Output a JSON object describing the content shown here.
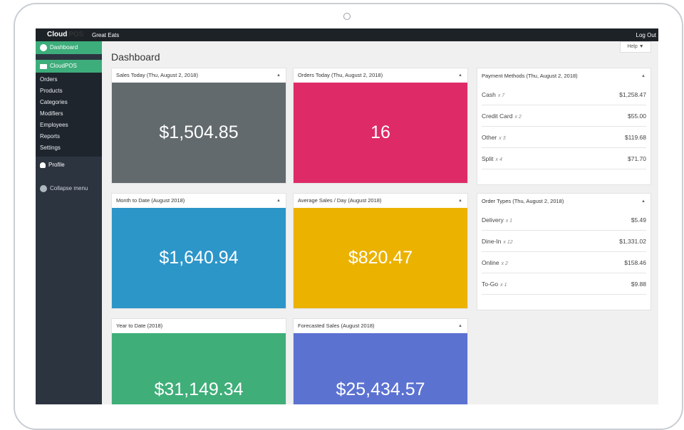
{
  "topbar": {
    "brand": "Cloud",
    "store": "Great Eats",
    "logout": "Log Out"
  },
  "sidebar": {
    "dashboard": "Dashboard",
    "cloudpos": "CloudPOS",
    "sub": [
      "Orders",
      "Products",
      "Categories",
      "Modifiers",
      "Employees",
      "Reports",
      "Settings"
    ],
    "profile": "Profile",
    "collapse": "Collapse menu"
  },
  "main": {
    "title": "Dashboard",
    "help": "Help ▼"
  },
  "cards": {
    "sales_today": {
      "title": "Sales Today (Thu, August 2, 2018)",
      "value": "$1,504.85",
      "color": "#626a6d"
    },
    "orders_today": {
      "title": "Orders Today (Thu, August 2, 2018)",
      "value": "16",
      "color": "#de2b68"
    },
    "month_to_date": {
      "title": "Month to Date (August 2018)",
      "value": "$1,640.94",
      "color": "#2d96c9"
    },
    "avg_sales": {
      "title": "Average Sales / Day (August 2018)",
      "value": "$820.47",
      "color": "#ecb200"
    },
    "year_to_date": {
      "title": "Year to Date (2018)",
      "value": "$31,149.34",
      "color": "#3fae79"
    },
    "forecast": {
      "title": "Forecasted Sales (August 2018)",
      "value": "$25,434.57",
      "color": "#5b72d1"
    }
  },
  "payment_methods": {
    "title": "Payment Methods (Thu, August 2, 2018)",
    "rows": [
      {
        "name": "Cash",
        "count": "x 7",
        "amount": "$1,258.47"
      },
      {
        "name": "Credit Card",
        "count": "x 2",
        "amount": "$55.00"
      },
      {
        "name": "Other",
        "count": "x 3",
        "amount": "$119.68"
      },
      {
        "name": "Split",
        "count": "x 4",
        "amount": "$71.70"
      }
    ]
  },
  "order_types": {
    "title": "Order Types (Thu, August 2, 2018)",
    "rows": [
      {
        "name": "Delivery",
        "count": "x 1",
        "amount": "$5.49"
      },
      {
        "name": "Dine-In",
        "count": "x 12",
        "amount": "$1,331.02"
      },
      {
        "name": "Online",
        "count": "x 2",
        "amount": "$158.46"
      },
      {
        "name": "To-Go",
        "count": "x 1",
        "amount": "$9.88"
      }
    ]
  },
  "caret": "▲"
}
